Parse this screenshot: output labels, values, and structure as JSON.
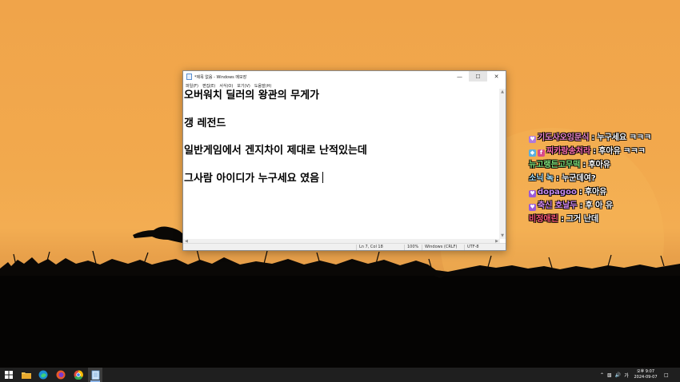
{
  "notepad": {
    "title": "*제목 없음 - Windows 메모장",
    "menu": [
      "파일(F)",
      "편집(E)",
      "서식(O)",
      "보기(V)",
      "도움말(H)"
    ],
    "lines": [
      "오버워치 딜러의 왕관의 무게가",
      "",
      "갱 레전드",
      "",
      "일반게임에서 겐지차이 제대로 난적있는데",
      "",
      "그사람 아이디가 누구세요 였음"
    ],
    "status": {
      "position": "Ln 7, Col 18",
      "zoom": "100%",
      "line_ending": "Windows (CRLF)",
      "encoding": "UTF-8"
    }
  },
  "chat": [
    {
      "badge": "heart",
      "badge_color": "#b07ad8",
      "name": "기도사오잉문식",
      "name_color": "#f08ad0",
      "message": "누구세요 ㅋㅋㅋ"
    },
    {
      "badge": "diamond+fan",
      "badge_color": "#5ab0e0",
      "name": "찌카랑송처라",
      "name_color": "#ff6fb0",
      "message": "후아유 ㅋㅋㅋ"
    },
    {
      "badge": "",
      "badge_color": "",
      "name": "뉴고랭든고무떡",
      "name_color": "#7ee07a",
      "message": "후아유"
    },
    {
      "badge": "",
      "badge_color": "",
      "name": "소닉 녹",
      "name_color": "#aee6ff",
      "message": "누군데여?"
    },
    {
      "badge": "heart",
      "badge_color": "#9a5ad8",
      "name": "dopagoo",
      "name_color": "#c48af0",
      "message": "후아유"
    },
    {
      "badge": "heart",
      "badge_color": "#9a5ad8",
      "name": "축신 호날두",
      "name_color": "#d28af0",
      "message": "후 아 유"
    },
    {
      "badge": "",
      "badge_color": "",
      "name": "비정애린",
      "name_color": "#ff5a7a",
      "message": "그거 난데"
    }
  ],
  "taskbar": {
    "apps": [
      "start-icon",
      "file-explorer-icon",
      "edge-icon",
      "firefox-icon",
      "chrome-icon",
      "notepad-icon"
    ],
    "tray": {
      "ime": "가",
      "time": "오후 9:07",
      "date": "2024-09-07"
    }
  },
  "colors": {
    "sky": "#f2a94d",
    "taskbar": "#1f1f1f",
    "notepad_status": "#f0f0f0"
  }
}
